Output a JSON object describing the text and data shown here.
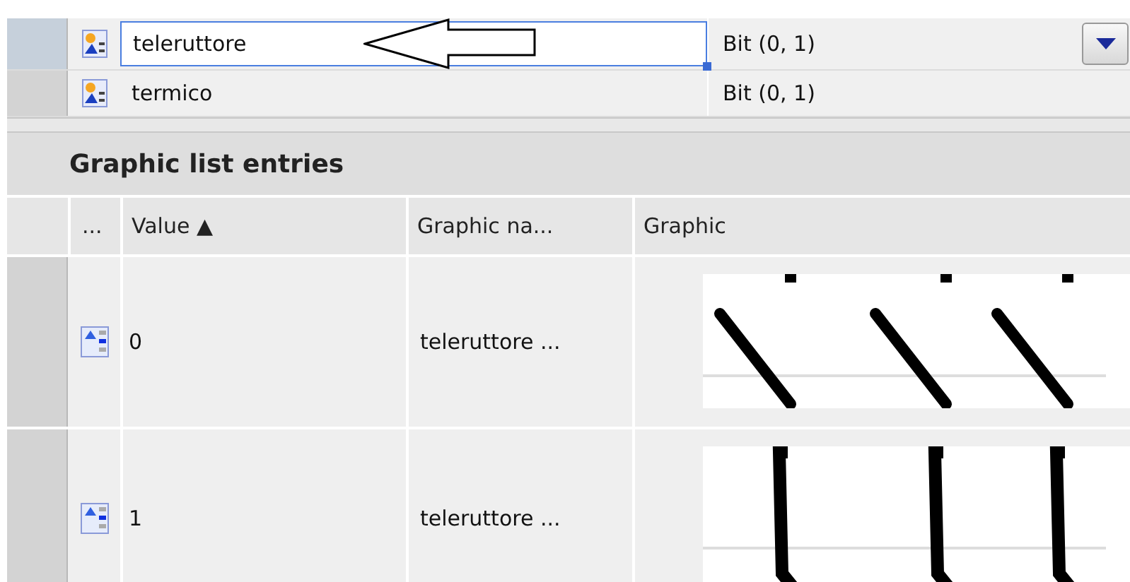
{
  "tags": [
    {
      "name": "teleruttore",
      "type": "Bit (0, 1)",
      "selected": true
    },
    {
      "name": "termico",
      "type": "Bit (0, 1)",
      "selected": false
    }
  ],
  "entries": {
    "title": "Graphic list entries",
    "columns": [
      "...",
      "Value ▲",
      "Graphic na...",
      "Graphic"
    ],
    "rows": [
      {
        "value": "0",
        "graphic_name": "teleruttore ...",
        "kind": "open"
      },
      {
        "value": "1",
        "graphic_name": "teleruttore ...",
        "kind": "closed"
      }
    ]
  }
}
